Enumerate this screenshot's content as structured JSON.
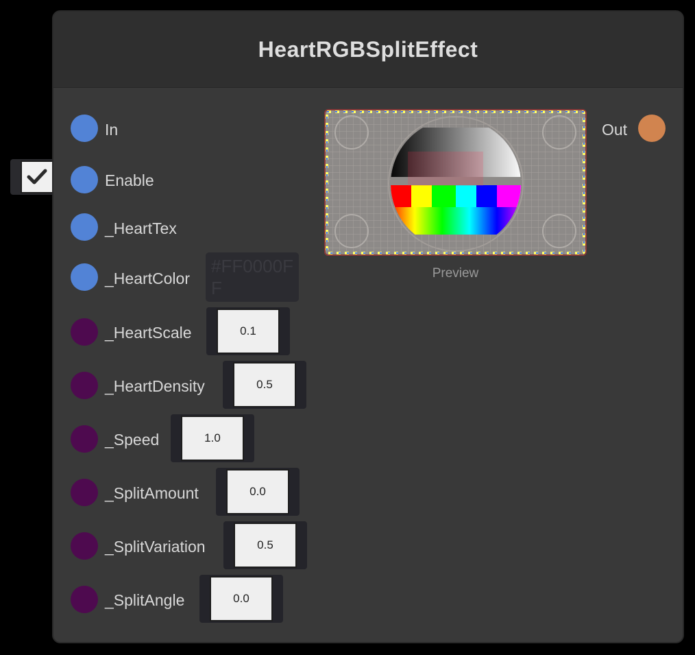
{
  "node": {
    "title": "HeartRGBSplitEffect",
    "output_label": "Out",
    "preview_label": "Preview",
    "inputs": [
      {
        "label": "In",
        "kind": "port"
      },
      {
        "label": "Enable",
        "kind": "toggle",
        "checked": true
      },
      {
        "label": "_HeartTex",
        "kind": "port"
      },
      {
        "label": "_HeartColor",
        "kind": "color",
        "value": "#FF0000FF"
      },
      {
        "label": "_HeartScale",
        "kind": "float",
        "value": "0.1"
      },
      {
        "label": "_HeartDensity",
        "kind": "float",
        "value": "0.5"
      },
      {
        "label": "_Speed",
        "kind": "float",
        "value": "1.0"
      },
      {
        "label": "_SplitAmount",
        "kind": "float",
        "value": "0.0"
      },
      {
        "label": "_SplitVariation",
        "kind": "float",
        "value": "0.5"
      },
      {
        "label": "_SplitAngle",
        "kind": "float",
        "value": "0.0"
      }
    ]
  },
  "colors": {
    "port_blue": "#5283d6",
    "port_purple": "#4e0a4f",
    "port_orange": "#d1844f",
    "node_body": "#393939",
    "node_header": "#2f2f2f"
  },
  "icons": {
    "toggle_check": "check-icon"
  }
}
